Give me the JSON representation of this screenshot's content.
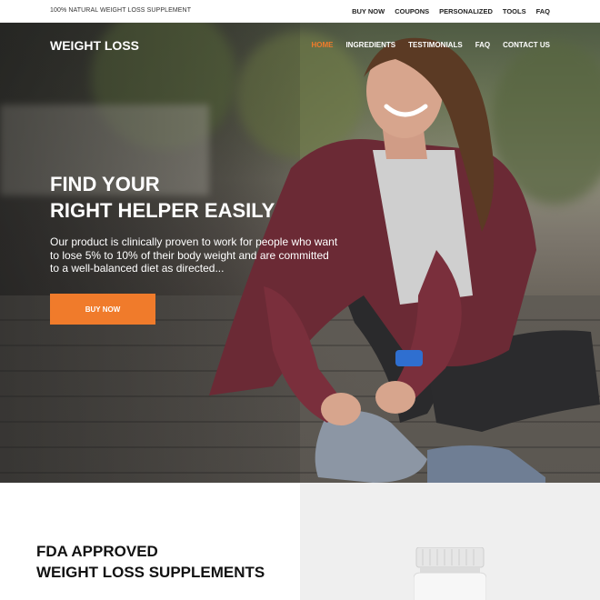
{
  "topbar": {
    "tagline": "100% NATURAL WEIGHT LOSS SUPPLEMENT",
    "links": [
      "BUY NOW",
      "COUPONS",
      "PERSONALIZED",
      "TOOLS",
      "FAQ"
    ]
  },
  "nav": {
    "logo": "WEIGHT LOSS",
    "items": [
      "HOME",
      "INGREDIENTS",
      "TESTIMONIALS",
      "FAQ",
      "CONTACT US"
    ],
    "active_index": 0
  },
  "hero": {
    "headline_line1": "FIND YOUR",
    "headline_line2": "RIGHT HELPER EASILY",
    "description": "Our product is clinically proven to work for people who want to lose 5% to 10% of their body weight and are committed to a well-balanced diet as directed...",
    "button_label": "BUY NOW"
  },
  "section2": {
    "title_line1": "FDA APPROVED",
    "title_line2": "WEIGHT LOSS SUPPLEMENTS"
  },
  "colors": {
    "accent": "#f07b2b",
    "text_dark": "#111111"
  }
}
